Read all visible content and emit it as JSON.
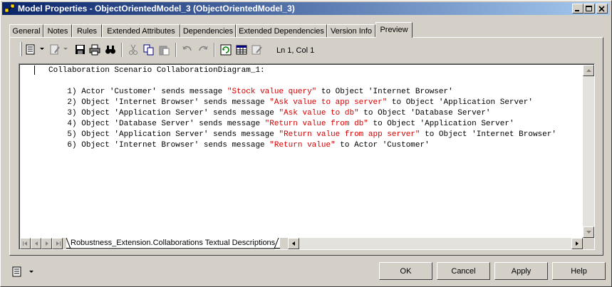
{
  "window": {
    "title": "Model Properties - ObjectOrientedModel_3 (ObjectOrientedModel_3)"
  },
  "title_buttons": [
    "minimize-icon",
    "maximize-icon",
    "close-icon"
  ],
  "tabs": [
    {
      "label": "General"
    },
    {
      "label": "Notes"
    },
    {
      "label": "Rules"
    },
    {
      "label": "Extended Attributes"
    },
    {
      "label": "Dependencies"
    },
    {
      "label": "Extended Dependencies"
    },
    {
      "label": "Version Info"
    },
    {
      "label": "Preview",
      "active": true
    }
  ],
  "toolbar": {
    "icons": [
      "properties-icon",
      "edit-icon",
      "save-icon",
      "print-icon",
      "find-icon",
      "cut-icon",
      "copy-icon",
      "paste-icon",
      "undo-icon",
      "redo-icon",
      "refresh-icon",
      "grid-icon",
      "edit-document-icon"
    ],
    "cursor_position": "Ln 1, Col 1"
  },
  "editor": {
    "heading": "Collaboration Scenario CollaborationDiagram_1:",
    "lines": [
      {
        "num": "1)",
        "pre": "Actor 'Customer' sends message ",
        "msg": "\"Stock value query\"",
        "post": " to Object 'Internet Browser'"
      },
      {
        "num": "2)",
        "pre": "Object 'Internet Browser' sends message ",
        "msg": "\"Ask value to app server\"",
        "post": " to Object 'Application Server'"
      },
      {
        "num": "3)",
        "pre": "Object 'Application Server' sends message ",
        "msg": "\"Ask value to db\"",
        "post": " to Object 'Database Server'"
      },
      {
        "num": "4)",
        "pre": "Object 'Database Server' sends message ",
        "msg": "\"Return value from db\"",
        "post": " to Object 'Application Server'"
      },
      {
        "num": "5)",
        "pre": "Object 'Application Server' sends message ",
        "msg": "\"Return value from app server\"",
        "post": " to Object 'Internet Browser'"
      },
      {
        "num": "6)",
        "pre": "Object 'Internet Browser' sends message ",
        "msg": "\"Return value\"",
        "post": " to Actor 'Customer'"
      }
    ],
    "string_color": "#d40000"
  },
  "sheet_tab": {
    "label": "Robustness_Extension.Collaborations Textual Descriptions"
  },
  "buttons": {
    "ok": "OK",
    "cancel": "Cancel",
    "apply": "Apply",
    "help": "Help"
  },
  "colors": {
    "titlebar_start": "#0a246a",
    "titlebar_end": "#a6caf0",
    "face": "#d4d0c8"
  }
}
